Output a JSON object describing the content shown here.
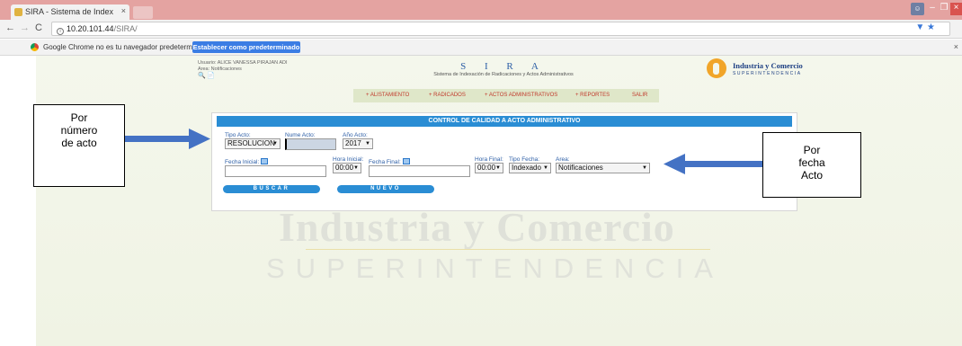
{
  "browser": {
    "tab_title": "SIRA - Sistema de Index",
    "tab_close": "×",
    "url_host": "10.20.101.44",
    "url_path": "/SIRA/",
    "back": "←",
    "forward": "→",
    "reload": "C",
    "info_icon": "i",
    "omni_icons": "▼ ★",
    "win_minimize": "–",
    "win_maximize": "❐",
    "win_close": "×",
    "infobar_message": "Google Chrome no es tu navegador predeterminado.",
    "infobar_button": "Establecer como predeterminado",
    "infobar_close": "×"
  },
  "header": {
    "user_line": "Usuario: ALICE VANESSA PIRAJAN ADI",
    "area_line": "Area: Notificaciones",
    "app_name": "S I R A",
    "app_subtitle": "Sistema de Indexación de Radicaciones y Actos Administrativos",
    "logo_line1": "Industria y Comercio",
    "logo_line2": "SUPERINTENDENCIA"
  },
  "menu": [
    "+ ALISTAMIENTO",
    "+ RADICADOS",
    "+ ACTOS ADMINISTRATIVOS",
    "+ REPORTES",
    "SALIR"
  ],
  "watermark": {
    "line1": "Industria y Comercio",
    "line2": "SUPERINTENDENCIA"
  },
  "form": {
    "title": "CONTROL DE CALIDAD A ACTO ADMINISTRATIVO",
    "tipo_acto_label": "Tipo Acto:",
    "tipo_acto_value": "RESOLUCION",
    "numero_acto_label": "Nume Acto:",
    "numero_acto_value": "",
    "anio_acto_label": "Año Acto:",
    "anio_acto_value": "2017",
    "fecha_inicial_label": "Fecha Inicial:",
    "hora_inicial_label": "Hora Inicial:",
    "hora_inicial_value": "00:00",
    "fecha_final_label": "Fecha Final:",
    "hora_final_label": "Hora Final:",
    "hora_final_value": "00:00",
    "tipo_fecha_label": "Tipo Fecha:",
    "tipo_fecha_value": "Indexado",
    "area_label": "Area:",
    "area_value": "Notificaciones",
    "buscar_label": "BUSCAR",
    "nuevo_label": "NUEVO"
  },
  "annotations": {
    "left_callout": [
      "Por",
      "número",
      "de acto"
    ],
    "right_callout": [
      "Por",
      "fecha",
      "Acto"
    ],
    "arrow_color": "#4472c4"
  }
}
